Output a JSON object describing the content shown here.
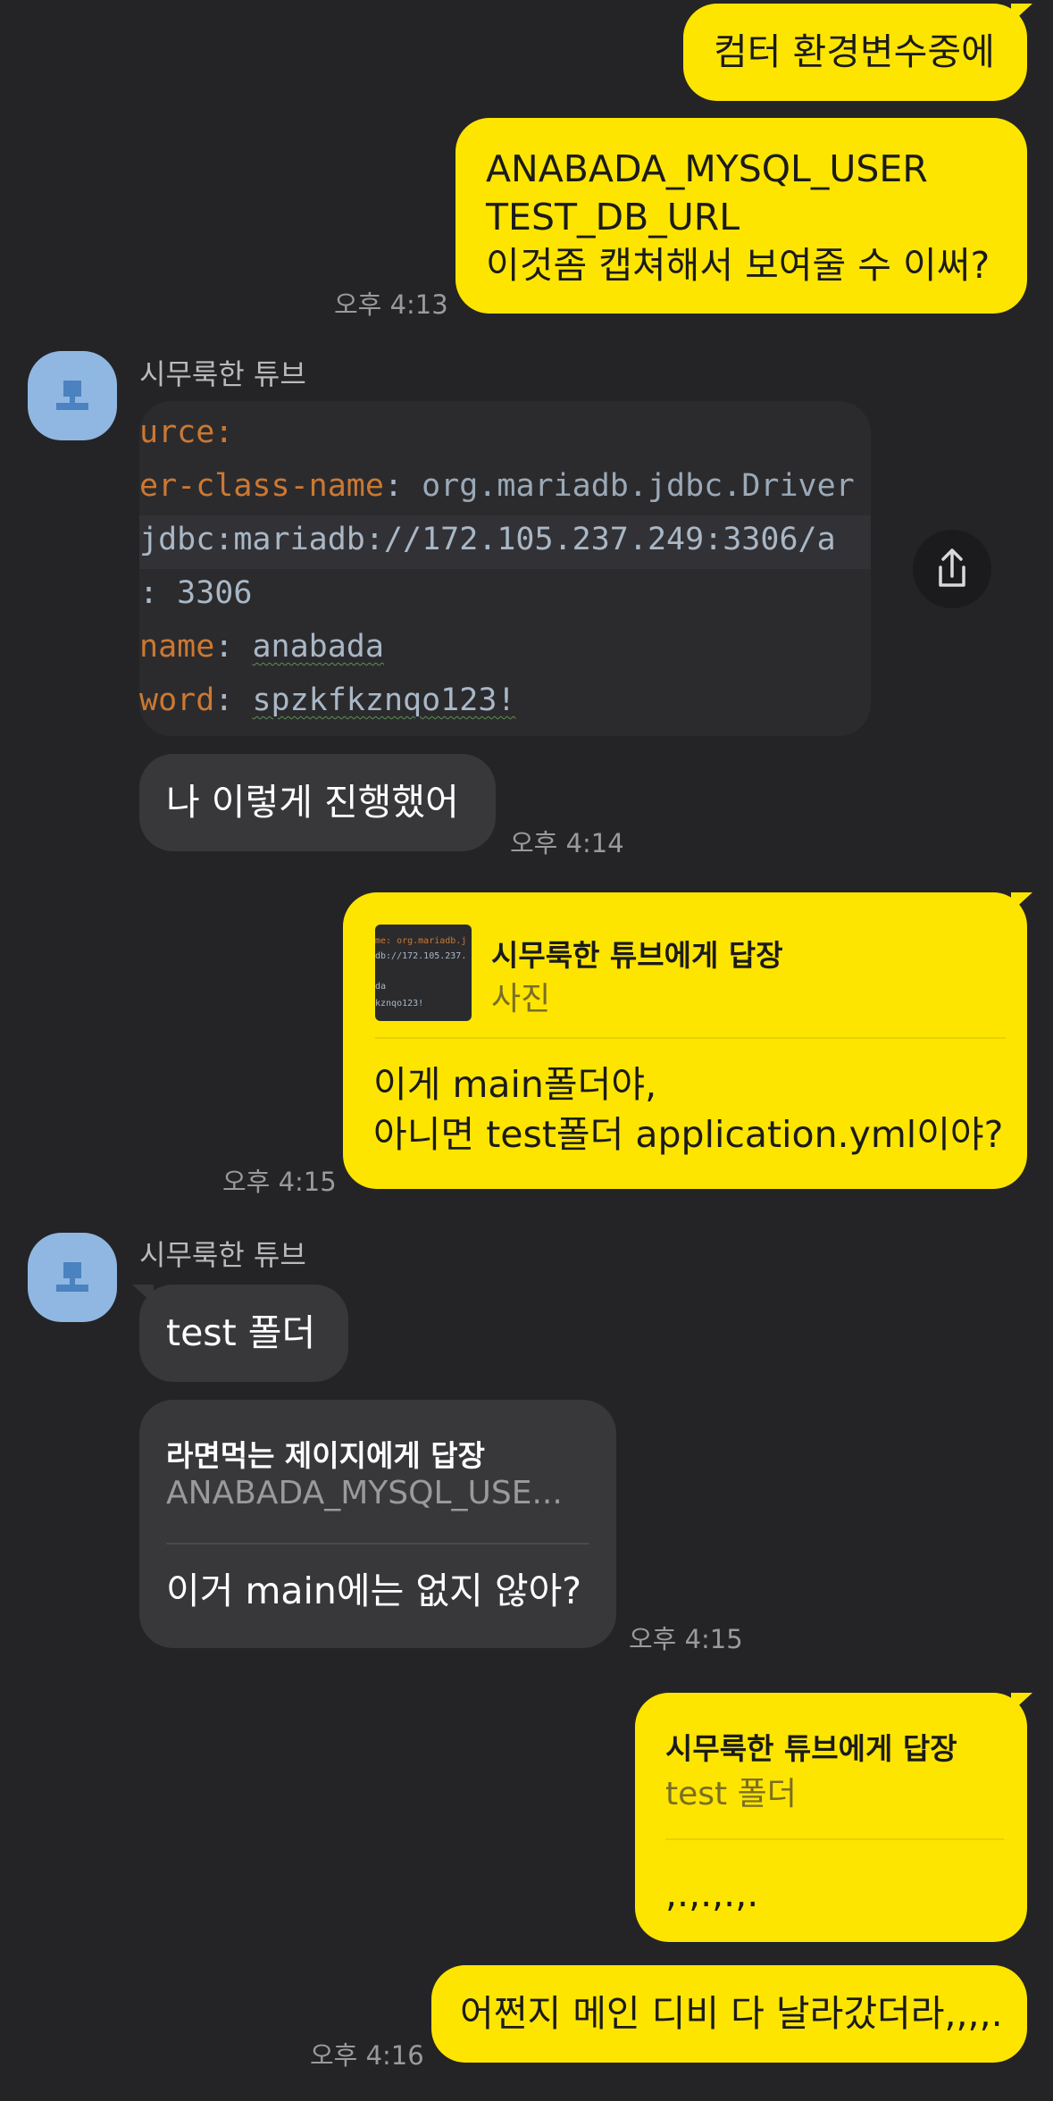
{
  "colors": {
    "background": "#242426",
    "my_bubble": "#FEE500",
    "their_bubble": "#38383B",
    "avatar": "#8fb7e2"
  },
  "messages": {
    "m1": {
      "text": "컴터 환경변수중에"
    },
    "m2": {
      "lines": [
        "ANABADA_MYSQL_USER",
        "TEST_DB_URL",
        "이것좀 캡쳐해서 보여줄 수 이써?"
      ],
      "time": "오후 4:13"
    },
    "sender1": {
      "name": "시무룩한 튜브"
    },
    "code_image": {
      "lines": [
        {
          "key": "urce",
          "sep": ":",
          "val": ""
        },
        {
          "key": "er-class-name",
          "sep": ": ",
          "val": "org.mariadb.jdbc.Driver"
        },
        {
          "key": "",
          "sep": " ",
          "val": "jdbc:mariadb://172.105.237.249:3306/a"
        },
        {
          "key": "",
          "sep": ": ",
          "val": "3306"
        },
        {
          "key": "name",
          "sep": ": ",
          "val": "anabada"
        },
        {
          "key": "word",
          "sep": ": ",
          "val": "spzkfkznqo123!"
        }
      ],
      "share_icon": "share-icon"
    },
    "m3": {
      "text": "나 이렇게 진행했어",
      "time": "오후 4:14"
    },
    "m4": {
      "reply_title": "시무룩한 튜브에게 답장",
      "reply_sub": "사진",
      "thumb_lines": [
        "me: org.mariadb.j",
        "db://172.105.237.",
        "",
        "da",
        "kznqo123!"
      ],
      "lines": [
        "이게 main폴더야,",
        "아니면 test폴더 application.yml이야?"
      ],
      "time": "오후 4:15"
    },
    "sender2": {
      "name": "시무룩한 튜브"
    },
    "m5": {
      "text": "test 폴더"
    },
    "m6": {
      "reply_title": "라면먹는 제이지에게 답장",
      "reply_sub": "ANABADA_MYSQL_USE...",
      "text": "이거 main에는 없지 않아?",
      "time": "오후 4:15"
    },
    "m7": {
      "reply_title": "시무룩한 튜브에게 답장",
      "reply_sub": "test 폴더",
      "text": ",.,.,.,."
    },
    "m8": {
      "text": "어쩐지 메인 디비 다 날라갔더라,,,,.",
      "time": "오후 4:16"
    }
  }
}
